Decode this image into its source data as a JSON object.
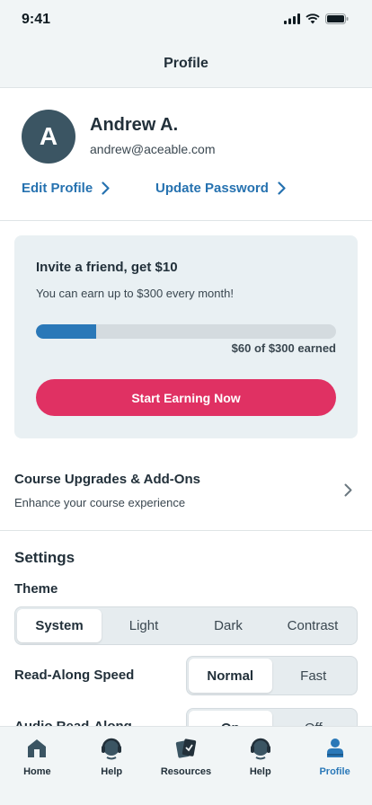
{
  "status_bar": {
    "time": "9:41"
  },
  "header": {
    "title": "Profile"
  },
  "profile": {
    "initial": "A",
    "name": "Andrew A.",
    "email": "andrew@aceable.com",
    "edit_link": "Edit Profile",
    "password_link": "Update Password"
  },
  "invite": {
    "title": "Invite a friend, get $10",
    "subtitle": "You can earn up to $300 every month!",
    "earned_fraction": 0.2,
    "progress_label": "$60 of $300 earned",
    "cta": "Start Earning Now"
  },
  "upgrades": {
    "title": "Course Upgrades & Add-Ons",
    "subtitle": "Enhance your course experience"
  },
  "settings": {
    "heading": "Settings",
    "theme_label": "Theme",
    "theme_options": [
      "System",
      "Light",
      "Dark",
      "Contrast"
    ],
    "theme_selected": "System",
    "speed_label": "Read-Along Speed",
    "speed_options": [
      "Normal",
      "Fast"
    ],
    "speed_selected": "Normal",
    "audio_label": "Audio Read-Along",
    "audio_options": [
      "On",
      "Off"
    ],
    "audio_selected": "On"
  },
  "tabs": [
    {
      "label": "Home",
      "icon": "home-icon"
    },
    {
      "label": "Help",
      "icon": "headset-icon"
    },
    {
      "label": "Resources",
      "icon": "cards-icon"
    },
    {
      "label": "Help",
      "icon": "headset-icon"
    },
    {
      "label": "Profile",
      "icon": "person-icon",
      "active": true
    }
  ],
  "colors": {
    "accent": "#2a78b8",
    "cta": "#e03163",
    "link": "#2672b0"
  }
}
